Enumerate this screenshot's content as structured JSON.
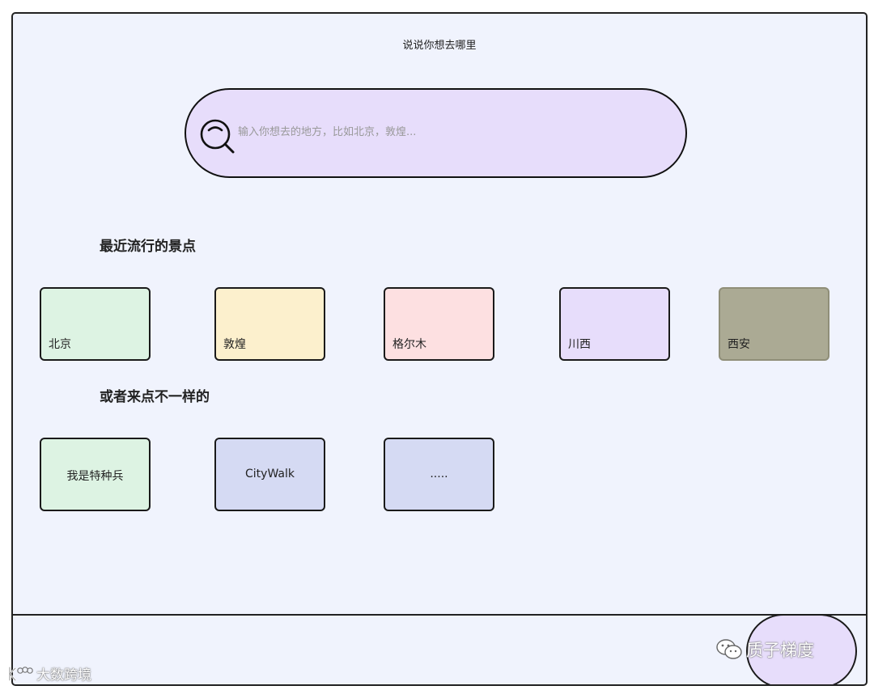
{
  "page": {
    "title": "说说你想去哪里"
  },
  "search": {
    "placeholder": "输入你想去的地方，比如北京，敦煌...",
    "value": "",
    "icon": "search-icon"
  },
  "popular": {
    "heading": "最近流行的景点",
    "items": [
      {
        "label": "北京",
        "color": "#ddf3e3"
      },
      {
        "label": "敦煌",
        "color": "#fcf0cd"
      },
      {
        "label": "格尔木",
        "color": "#fde0e1"
      },
      {
        "label": "川西",
        "color": "#e7ddfb"
      },
      {
        "label": "西安",
        "color": "#abaa94"
      }
    ]
  },
  "alternative": {
    "heading": "或者来点不一样的",
    "items": [
      {
        "label": "我是特种兵",
        "color": "#ddf3e3"
      },
      {
        "label": "CityWalk",
        "color": "#d5daf3"
      },
      {
        "label": ".....",
        "color": "#d5daf3"
      }
    ]
  },
  "watermarks": {
    "right": "质子梯度",
    "left": "大数跨境"
  },
  "colors": {
    "background": "#f0f3fd",
    "accent": "#e7ddfb",
    "border": "#1a1a1a"
  }
}
